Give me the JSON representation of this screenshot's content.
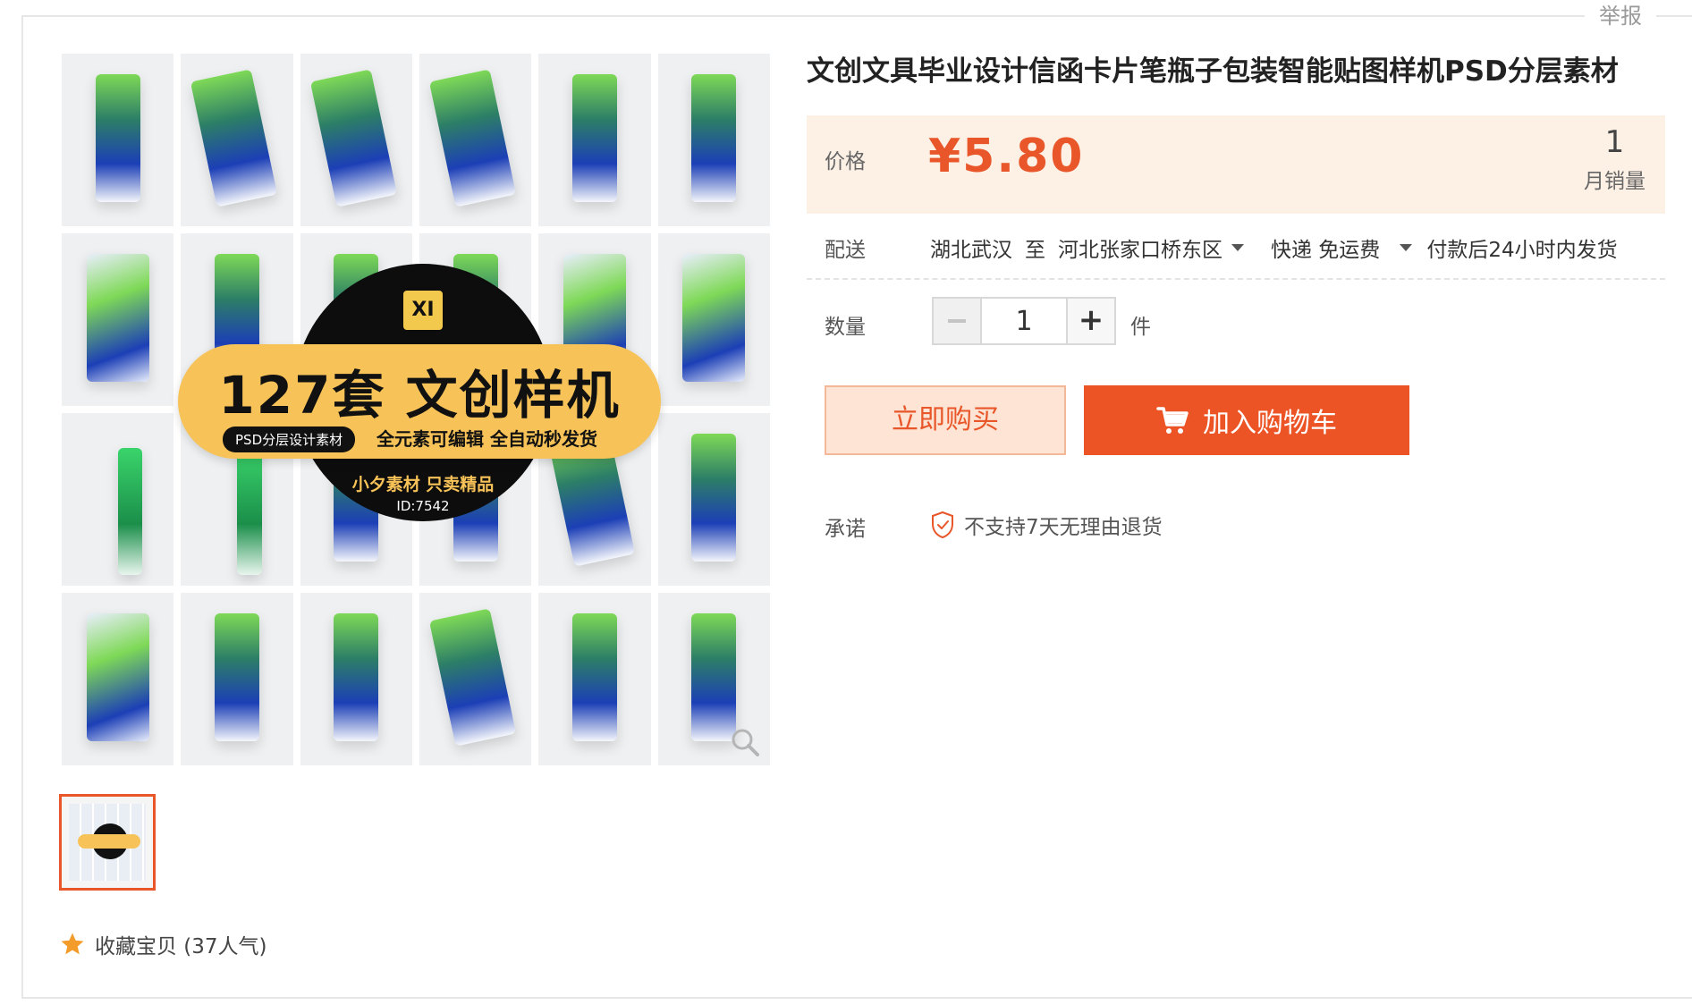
{
  "report_label": "举报",
  "gallery": {
    "badge": {
      "logo": "XI",
      "headline": "127套 文创样机",
      "tag_left": "PSD分层设计素材",
      "tag_right": "全元素可编辑 全自动秒发货",
      "sub": "小夕素材 只卖精品",
      "id": "ID:7542"
    }
  },
  "favorite": {
    "label": "收藏宝贝 (37人气)"
  },
  "product": {
    "title": "文创文具毕业设计信函卡片笔瓶子包装智能贴图样机PSD分层素材",
    "price_label": "价格",
    "price": "¥5.80",
    "monthly_sales_value": "1",
    "monthly_sales_label": "月销量"
  },
  "shipping": {
    "label": "配送",
    "origin": "湖北武汉",
    "to": "至",
    "destination": "河北张家口桥东区",
    "method": "快递 免运费",
    "dispatch": "付款后24小时内发货"
  },
  "quantity": {
    "label": "数量",
    "value": "1",
    "unit": "件",
    "plus": "+"
  },
  "actions": {
    "buy_now": "立即购买",
    "add_to_cart": "加入购物车"
  },
  "promise": {
    "label": "承诺",
    "item": "不支持7天无理由退货"
  },
  "colors": {
    "accent": "#e8562a",
    "cart_bg": "#ec5426",
    "price_bg": "#fdf0e5"
  }
}
